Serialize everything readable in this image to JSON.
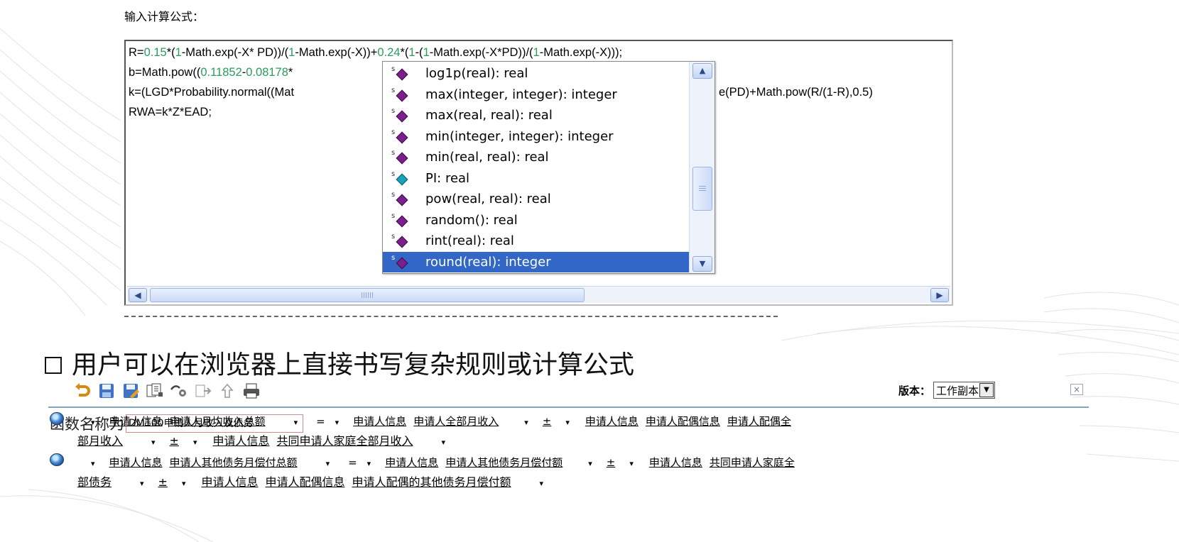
{
  "editor": {
    "label": "输入计算公式：",
    "code_lines": [
      [
        "R=",
        "0.15",
        "*(",
        "1",
        "-Math.exp(-X* PD))/(",
        "1",
        "-Math.exp(-X))+",
        "0.24",
        "*(",
        "1",
        "-(",
        "1",
        "-Math.exp(-X*PD))/(",
        "1",
        "-Math.exp(-X)));"
      ],
      [
        "b=Math.pow((",
        "0.11852",
        "-",
        "0.08178",
        "*"
      ],
      [
        "k=(LGD*Probability.normal((Mat"
      ],
      [
        "RWA=k*Z*EAD;"
      ]
    ],
    "code_line2_tail": "e(PD)+Math.pow(R/(1-R),0.5)",
    "autocomplete": {
      "items": [
        {
          "label": "log1p(real): real",
          "icon": "method-icon"
        },
        {
          "label": "max(integer, integer): integer",
          "icon": "method-icon"
        },
        {
          "label": "max(real, real): real",
          "icon": "method-icon"
        },
        {
          "label": "min(integer, integer): integer",
          "icon": "method-icon"
        },
        {
          "label": "min(real, real): real",
          "icon": "method-icon"
        },
        {
          "label": "PI: real",
          "icon": "field-icon"
        },
        {
          "label": "pow(real, real): real",
          "icon": "method-icon"
        },
        {
          "label": "random(): real",
          "icon": "method-icon"
        },
        {
          "label": "rint(real): real",
          "icon": "method-icon"
        },
        {
          "label": "round(real): integer",
          "icon": "method-icon"
        }
      ],
      "selected_index": 9
    },
    "scroll_grip": "IIII"
  },
  "heading": "用户可以在浏览器上直接书写复杂规则或计算公式",
  "panel": {
    "toolbar_icons": [
      "undo-icon",
      "save-icon",
      "save-as-icon",
      "copy-icon",
      "link-icon",
      "export-icon",
      "upload-icon",
      "print-icon"
    ],
    "version_label": "版本：",
    "version_value": "工作副本",
    "close": "×",
    "fn_label": "函数名称为",
    "fn_value": "DM100申请人月收入及债务"
  },
  "rules": [
    {
      "line1": {
        "lhs": [
          "申请人信息",
          "申请人月均收入总额"
        ],
        "rhs1": [
          "申请人信息",
          "申请人全部月收入"
        ],
        "rhs2": [
          "申请人信息",
          "申请人配偶信息",
          "申请人配偶全"
        ]
      },
      "line2": {
        "cont": "部月收入",
        "rhs3": [
          "申请人信息",
          "共同申请人家庭全部月收入"
        ]
      }
    },
    {
      "line1": {
        "lhs": [
          "申请人信息",
          "申请人其他债务月偿付总额"
        ],
        "rhs1": [
          "申请人信息",
          "申请人其他债务月偿付额"
        ],
        "rhs2": [
          "申请人信息",
          "共同申请人家庭全"
        ]
      },
      "line2": {
        "cont": "部债务",
        "rhs3": [
          "申请人信息",
          "申请人配偶信息",
          "申请人配偶的其他债务月偿付额"
        ]
      }
    }
  ],
  "symbols": {
    "dropdown": "▾",
    "eq": "=",
    "pm": "±",
    "up": "▲",
    "down": "▼",
    "left": "◀",
    "right": "▶",
    "method_marker": "s"
  }
}
